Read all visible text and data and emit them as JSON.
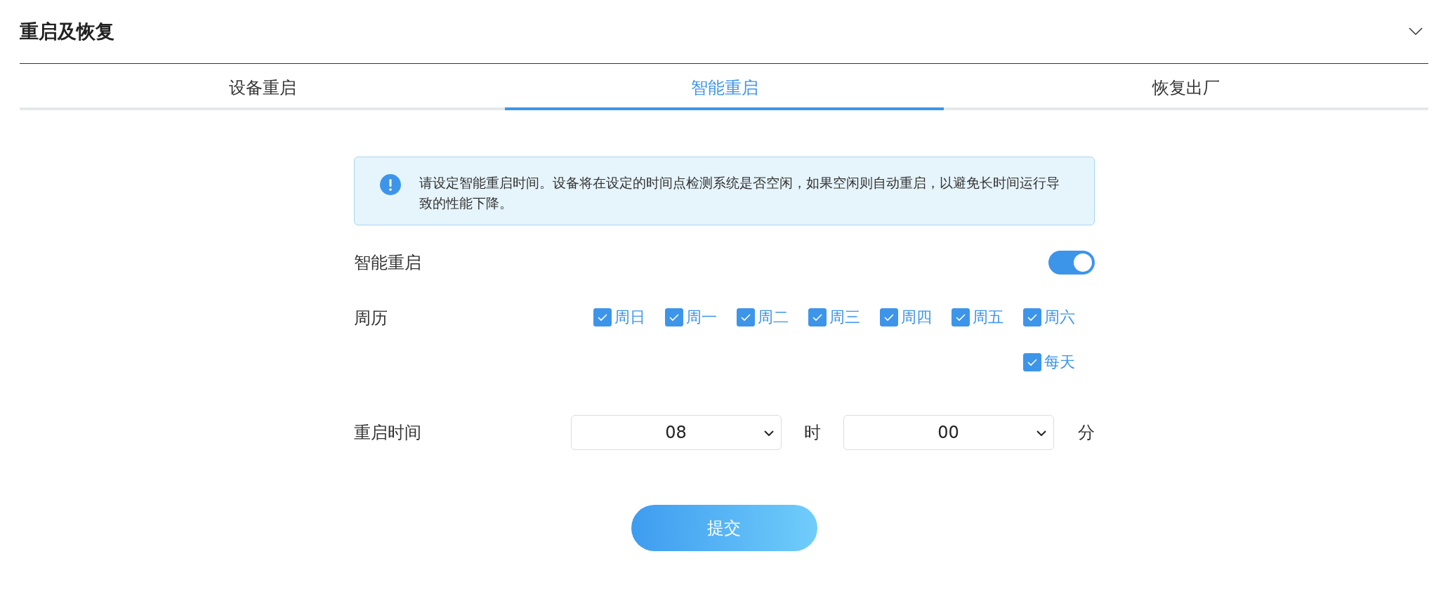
{
  "section": {
    "title": "重启及恢复",
    "expanded": true
  },
  "tabs": [
    {
      "label": "设备重启",
      "selected": false
    },
    {
      "label": "智能重启",
      "selected": true
    },
    {
      "label": "恢复出厂",
      "selected": false
    }
  ],
  "notice": {
    "text": "请设定智能重启时间。设备将在设定的时间点检测系统是否空闲，如果空闲则自动重启，以避免长时间运行导致的性能下降。"
  },
  "smart_reboot": {
    "label": "智能重启",
    "on": true
  },
  "weekdays": {
    "label": "周历",
    "options": [
      {
        "label": "周日",
        "checked": true
      },
      {
        "label": "周一",
        "checked": true
      },
      {
        "label": "周二",
        "checked": true
      },
      {
        "label": "周三",
        "checked": true
      },
      {
        "label": "周四",
        "checked": true
      },
      {
        "label": "周五",
        "checked": true
      },
      {
        "label": "周六",
        "checked": true
      },
      {
        "label": "每天",
        "checked": true
      }
    ]
  },
  "reboot_time": {
    "label": "重启时间",
    "hour": "08",
    "hour_unit": "时",
    "minute": "00",
    "minute_unit": "分"
  },
  "submit": "提交"
}
